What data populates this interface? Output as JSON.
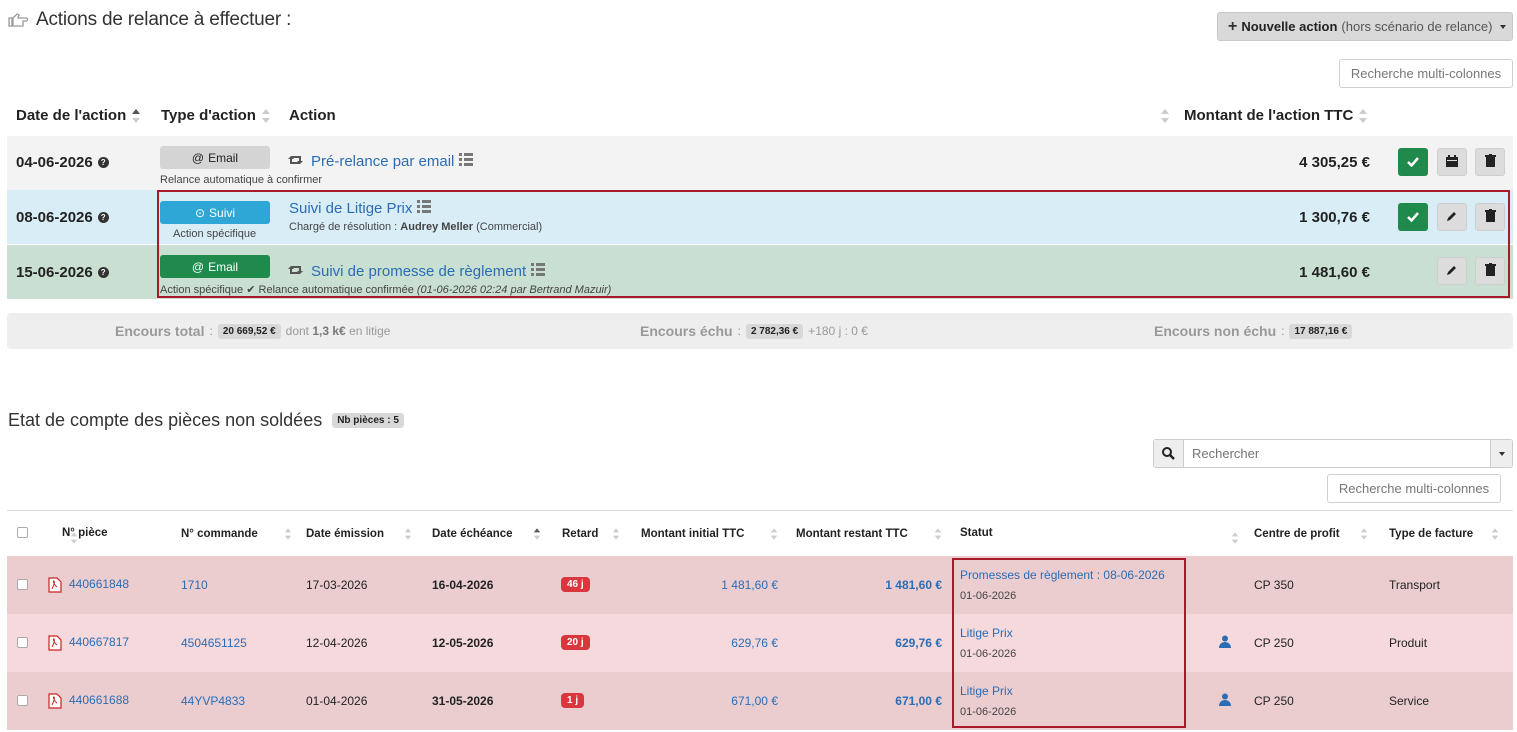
{
  "header": {
    "title": "Actions de relance à effectuer :",
    "new_action_bold": "Nouvelle action",
    "new_action_sub": "(hors scénario de relance)",
    "search_multi": "Recherche multi-colonnes"
  },
  "actions_table": {
    "columns": [
      "Date de l'action",
      "Type d'action",
      "Action",
      "Montant de l'action TTC"
    ],
    "rows": [
      {
        "date": "04-06-2026",
        "type": "Email",
        "type_sub": "Relance automatique à confirmer",
        "action": "Pré-relance par email",
        "amount": "4 305,25 €"
      },
      {
        "date": "08-06-2026",
        "type": "Suivi",
        "type_sub": "Action spécifique",
        "action": "Suivi de Litige Prix",
        "detail_label": "Chargé de résolution :",
        "detail_name": "Audrey Meller",
        "detail_role": "(Commercial)",
        "amount": "1 300,76 €"
      },
      {
        "date": "15-06-2026",
        "type": "Email",
        "type_sub": "Action spécifique",
        "confirm_text": "Relance automatique confirmée",
        "confirm_meta": "(01-06-2026 02:24 par Bertrand Mazuir)",
        "action": "Suivi de promesse de règlement",
        "amount": "1 481,60 €"
      }
    ]
  },
  "encours": {
    "total_label": "Encours total",
    "total_value": "20 669,52 €",
    "total_dont_prefix": "dont",
    "total_dont_value": "1,3 k€",
    "total_dont_suffix": "en litige",
    "echu_label": "Encours échu",
    "echu_value": "2 782,36 €",
    "echu_extra": "+180 j : 0 €",
    "non_echu_label": "Encours non échu",
    "non_echu_value": "17 887,16 €"
  },
  "pieces": {
    "title": "Etat de compte des pièces non soldées",
    "count_badge": "Nb pièces : 5",
    "search_placeholder": "Rechercher",
    "search_multi": "Recherche multi-colonnes",
    "columns": [
      "N° pièce",
      "N° commande",
      "Date émission",
      "Date échéance",
      "Retard",
      "Montant initial TTC",
      "Montant restant TTC",
      "Statut",
      "Centre de profit",
      "Type de facture"
    ],
    "rows": [
      {
        "piece": "440661848",
        "commande": "1710",
        "emission": "17-03-2026",
        "echeance": "16-04-2026",
        "retard": "46 j",
        "initial": "1 481,60 €",
        "restant": "1 481,60 €",
        "statut": "Promesses de règlement : 08-06-2026",
        "statut_date": "01-06-2026",
        "centre": "CP 350",
        "type": "Transport"
      },
      {
        "piece": "440667817",
        "commande": "4504651125",
        "emission": "12-04-2026",
        "echeance": "12-05-2026",
        "retard": "20 j",
        "initial": "629,76 €",
        "restant": "629,76 €",
        "statut": "Litige Prix",
        "statut_date": "01-06-2026",
        "centre": "CP 250",
        "type": "Produit"
      },
      {
        "piece": "440661688",
        "commande": "44YVP4833",
        "emission": "01-04-2026",
        "echeance": "31-05-2026",
        "retard": "1 j",
        "initial": "671,00 €",
        "restant": "671,00 €",
        "statut": "Litige Prix",
        "statut_date": "01-06-2026",
        "centre": "CP 250",
        "type": "Service"
      }
    ]
  },
  "colors": {
    "accent_blue": "#2a6db5",
    "suivi_blue": "#2fa7d6",
    "green": "#1f8a4c",
    "red": "#d9363e",
    "highlight_border": "#a8192a"
  }
}
